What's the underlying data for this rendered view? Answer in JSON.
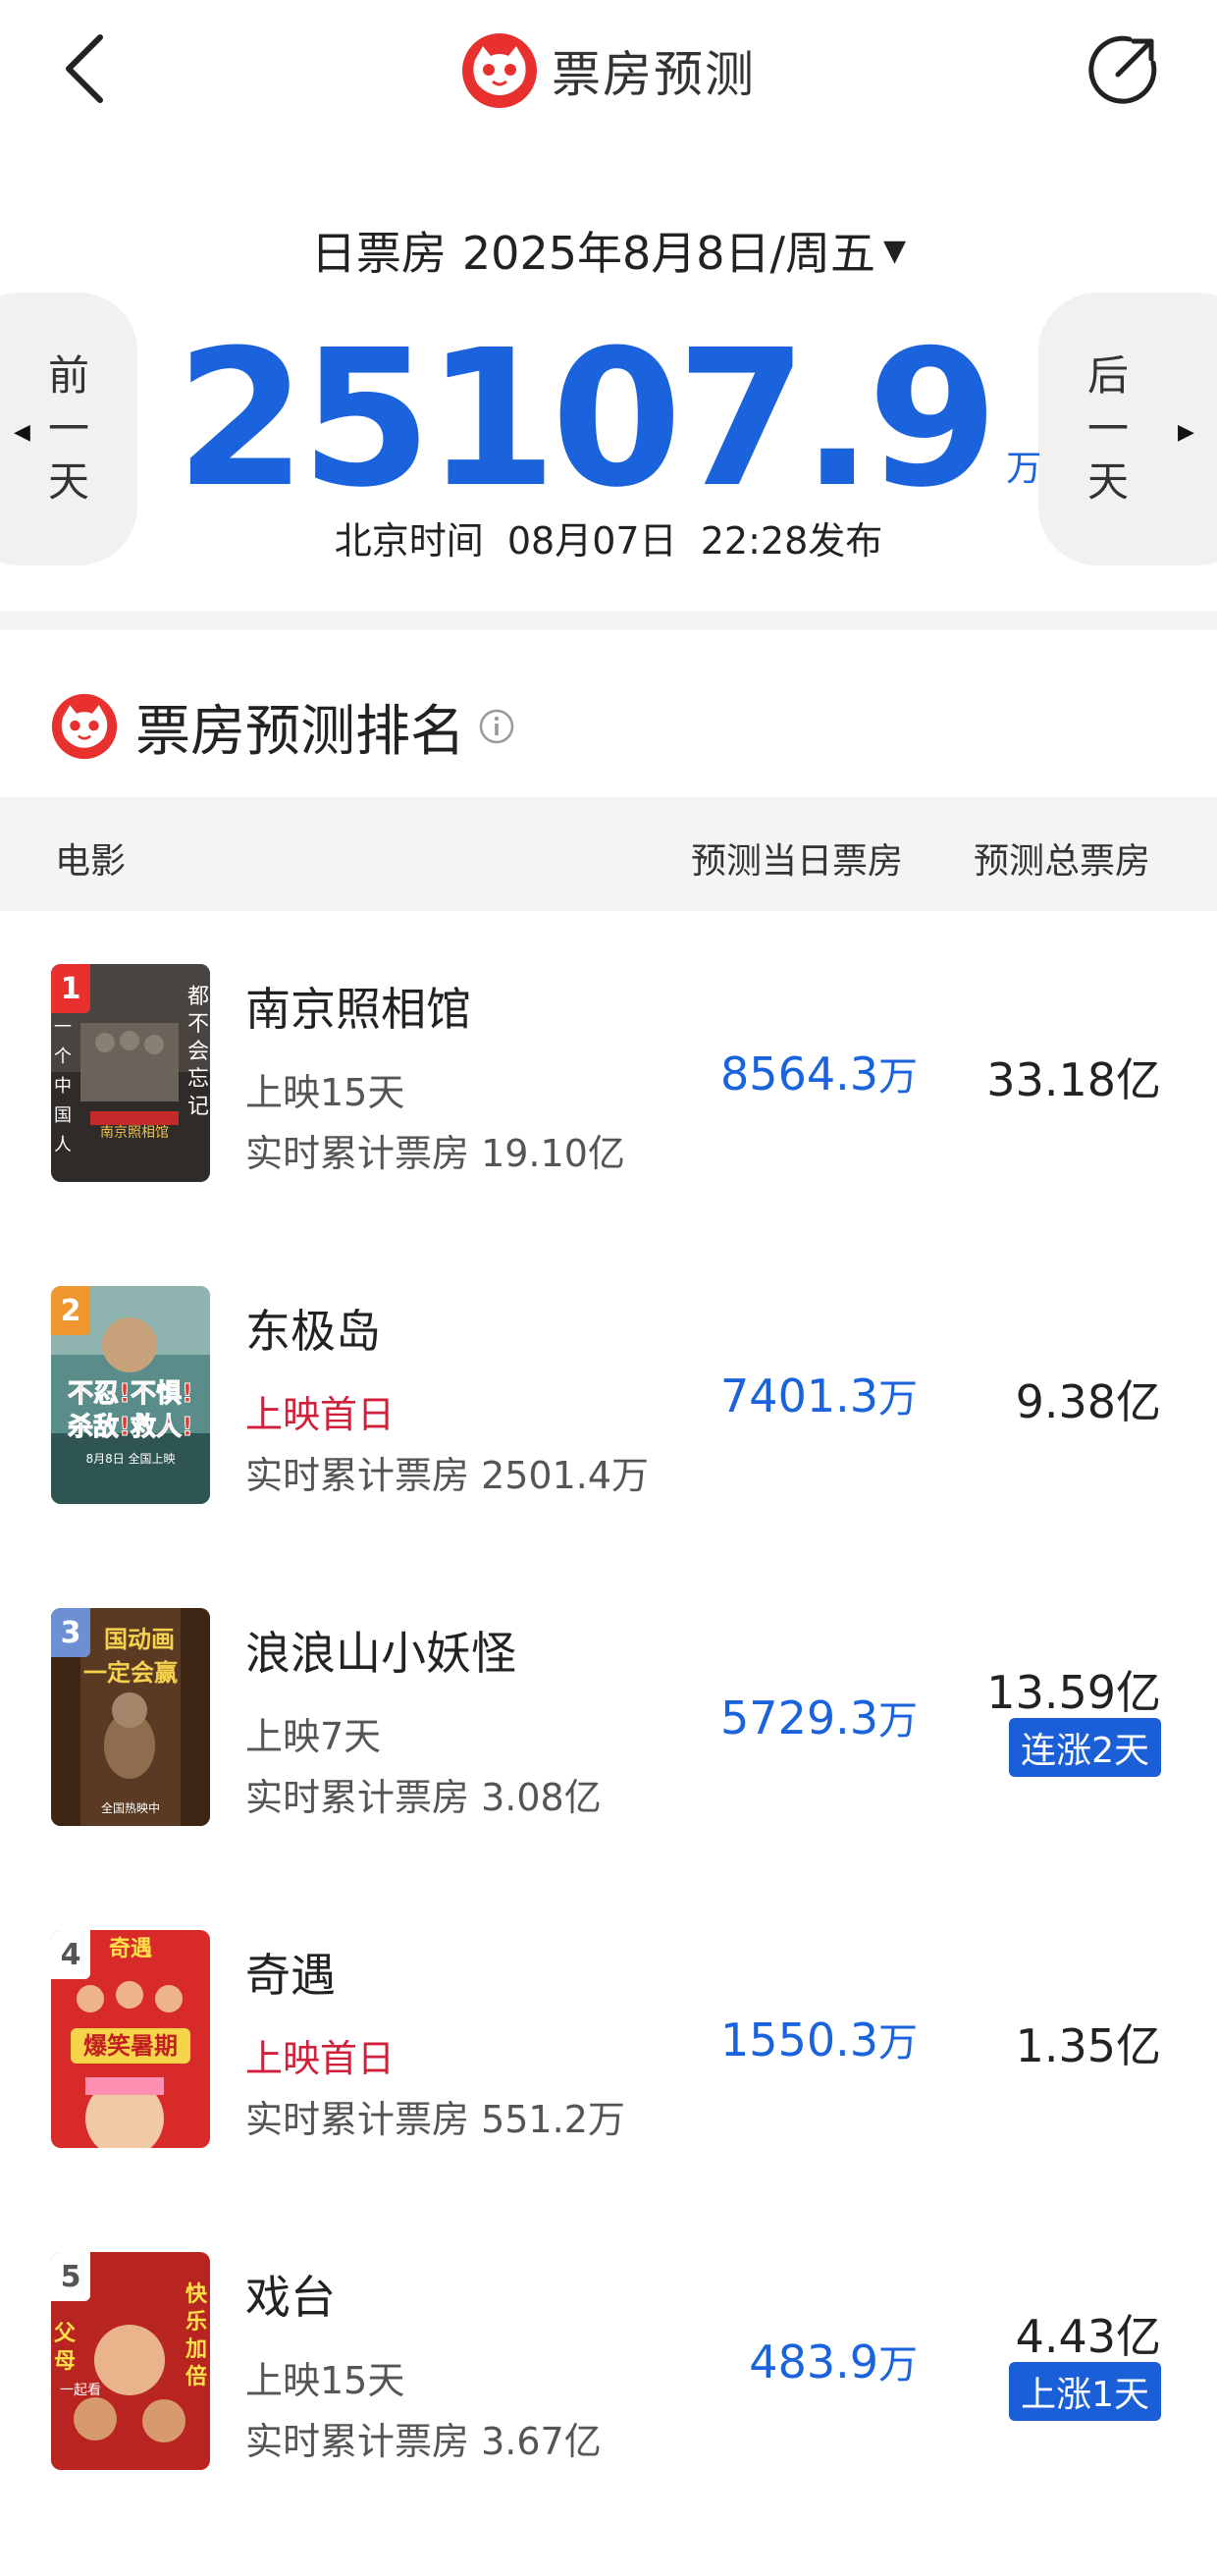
{
  "header": {
    "title": "票房预测"
  },
  "date": {
    "prefix": "日票房",
    "value": "2025年8月8日/周五",
    "caret": "▼"
  },
  "nav": {
    "prev": [
      "前",
      "一",
      "天"
    ],
    "next": [
      "后",
      "一",
      "天"
    ]
  },
  "summary": {
    "value": "25107.9",
    "unit": "万",
    "publish": "北京时间  08月07日  22:28发布"
  },
  "ranking": {
    "title": "票房预测排名",
    "columns": {
      "movie": "电影",
      "today": "预测当日票房",
      "total": "预测总票房"
    },
    "movies": [
      {
        "rank": "1",
        "name": "南京照相馆",
        "days": "上映15天",
        "cum": "实时累计票房 19.10亿",
        "today": "8564.3",
        "today_unit": "万",
        "total": "33.18亿",
        "tag": ""
      },
      {
        "rank": "2",
        "name": "东极岛",
        "days": "上映首日",
        "cum": "实时累计票房 2501.4万",
        "today": "7401.3",
        "today_unit": "万",
        "total": "9.38亿",
        "tag": ""
      },
      {
        "rank": "3",
        "name": "浪浪山小妖怪",
        "days": "上映7天",
        "cum": "实时累计票房 3.08亿",
        "today": "5729.3",
        "today_unit": "万",
        "total": "13.59亿",
        "tag": "连涨2天"
      },
      {
        "rank": "4",
        "name": "奇遇",
        "days": "上映首日",
        "cum": "实时累计票房 551.2万",
        "today": "1550.3",
        "today_unit": "万",
        "total": "1.35亿",
        "tag": ""
      },
      {
        "rank": "5",
        "name": "戏台",
        "days": "上映15天",
        "cum": "实时累计票房 3.67亿",
        "today": "483.9",
        "today_unit": "万",
        "total": "4.43亿",
        "tag": "上涨1天"
      }
    ]
  },
  "posters": {
    "p1": {
      "lines": [
        "都",
        "不",
        "会",
        "忘",
        "记"
      ],
      "left": [
        "一",
        "个",
        "中",
        "国",
        "人"
      ],
      "sub": "南京照相馆"
    },
    "p2": {
      "line1": "不忍!不惧!",
      "line2": "杀敌!救人!",
      "date": "8月8日 全国上映"
    },
    "p3": {
      "line1": "国动画",
      "line2": "一定会赢",
      "sub": "全国热映中"
    },
    "p4": {
      "top": "奇遇",
      "mid": "爆笑暑期"
    },
    "p5": {
      "right": [
        "快",
        "乐",
        "加",
        "倍"
      ],
      "left": [
        "父",
        "母"
      ],
      "bottom": "一起看"
    }
  },
  "colors": {
    "accent": "#1a63dd",
    "brand_red": "#e8312f",
    "first_day": "#d0213a",
    "tag_bg": "#1a5fd8"
  }
}
